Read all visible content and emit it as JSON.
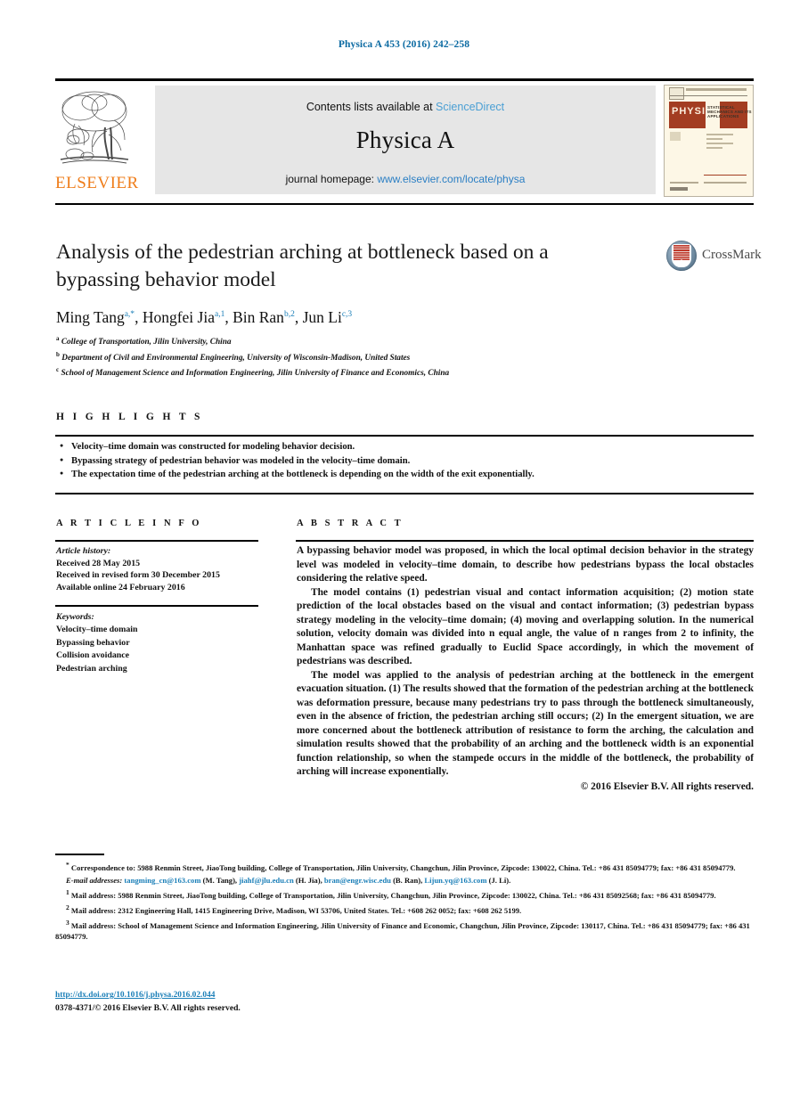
{
  "running_head": "Physica A 453 (2016) 242–258",
  "masthead": {
    "publisher": "ELSEVIER",
    "contents_prefix": "Contents lists available at",
    "contents_link": "ScienceDirect",
    "journal_title": "Physica A",
    "homepage_prefix": "journal homepage:",
    "homepage_link": "www.elsevier.com/locate/physa",
    "cover": {
      "banner": "PHYSICA",
      "subtitle": "STATISTICAL MECHANICS AND ITS APPLICATIONS"
    },
    "colors": {
      "link": "#2b7fc4",
      "sciencedirect": "#4a9fd4",
      "elsevier_orange": "#ef7d1a",
      "panel_bg": "#e6e6e6",
      "cover_banner": "#a33d22"
    }
  },
  "article": {
    "title": "Analysis of the pedestrian arching at bottleneck based on a bypassing behavior model",
    "authors": [
      {
        "name": "Ming Tang",
        "marks": "a,*"
      },
      {
        "name": "Hongfei Jia",
        "marks": "a,1"
      },
      {
        "name": "Bin Ran",
        "marks": "b,2"
      },
      {
        "name": "Jun Li",
        "marks": "c,3"
      }
    ],
    "affiliations": [
      {
        "mark": "a",
        "text": "College of Transportation, Jilin University, China"
      },
      {
        "mark": "b",
        "text": "Department of Civil and Environmental Engineering, University of Wisconsin-Madison, United States"
      },
      {
        "mark": "c",
        "text": "School of Management Science and Information Engineering, Jilin University of Finance and Economics, China"
      }
    ],
    "crossmark_label": "CrossMark"
  },
  "highlights": {
    "heading": "H I G H L I G H T S",
    "items": [
      "Velocity–time domain was constructed for modeling behavior decision.",
      "Bypassing strategy of pedestrian behavior was modeled in the velocity–time domain.",
      "The expectation time of the pedestrian arching at the bottleneck is depending on the width of the exit exponentially."
    ]
  },
  "article_info": {
    "heading": "A R T I C L E    I N F O",
    "history_label": "Article history:",
    "history": [
      "Received 28 May 2015",
      "Received in revised form 30 December 2015",
      "Available online 24 February 2016"
    ],
    "keywords_label": "Keywords:",
    "keywords": [
      "Velocity–time domain",
      "Bypassing behavior",
      "Collision avoidance",
      "Pedestrian arching"
    ]
  },
  "abstract": {
    "heading": "A B S T R A C T",
    "paragraphs": [
      "A bypassing behavior model was proposed, in which the local optimal decision behavior in the strategy level was modeled in velocity–time domain, to describe how pedestrians bypass the local obstacles considering the relative speed.",
      "The model contains (1) pedestrian visual and contact information acquisition; (2) motion state prediction of the local obstacles based on the visual and contact information; (3) pedestrian bypass strategy modeling in the velocity–time domain; (4) moving and overlapping solution. In the numerical solution, velocity domain was divided into n equal angle, the value of n ranges from 2 to infinity, the Manhattan space was refined gradually to Euclid Space accordingly, in which the movement of pedestrians was described.",
      "The model was applied to the analysis of pedestrian arching at the bottleneck in the emergent evacuation situation. (1) The results showed that the formation of the pedestrian arching at the bottleneck was deformation pressure, because many pedestrians try to pass through the bottleneck simultaneously, even in the absence of friction, the pedestrian arching still occurs; (2) In the emergent situation, we are more concerned about the bottleneck attribution of resistance to form the arching, the calculation and simulation results showed that the probability of an arching and the bottleneck width is an exponential function relationship, so when the stampede occurs in the middle of the bottleneck, the probability of arching will increase exponentially."
    ],
    "copyright": "© 2016 Elsevier B.V. All rights reserved."
  },
  "footnotes": {
    "correspondence": "Correspondence to: 5988 Renmin Street, JiaoTong building, College of Transportation, Jilin University, Changchun, Jilin Province, Zipcode: 130022, China. Tel.: +86 431 85094779; fax: +86 431 85094779.",
    "email_label": "E-mail addresses:",
    "emails": [
      {
        "address": "tangming_cn@163.com",
        "owner": "(M. Tang),"
      },
      {
        "address": "jiahf@jlu.edu.cn",
        "owner": "(H. Jia),"
      },
      {
        "address": "bran@engr.wisc.edu",
        "owner": "(B. Ran),"
      },
      {
        "address": "Lijun.yq@163.com",
        "owner": "(J. Li)."
      }
    ],
    "notes": [
      {
        "mark": "1",
        "text": "Mail address: 5988 Renmin Street, JiaoTong building, College of Transportation, Jilin University, Changchun, Jilin Province, Zipcode: 130022, China. Tel.: +86 431 85092568; fax: +86 431 85094779."
      },
      {
        "mark": "2",
        "text": "Mail address: 2312 Engineering Hall, 1415 Engineering Drive, Madison, WI 53706, United States. Tel.: +608 262 0052; fax: +608 262 5199."
      },
      {
        "mark": "3",
        "text": "Mail address: School of Management Science and Information Engineering, Jilin University of Finance and Economic, Changchun, Jilin Province, Zipcode: 130117, China. Tel.: +86 431 85094779; fax: +86 431 85094779."
      }
    ]
  },
  "footer": {
    "doi": "http://dx.doi.org/10.1016/j.physa.2016.02.044",
    "issn": "0378-4371/© 2016 Elsevier B.V. All rights reserved."
  }
}
